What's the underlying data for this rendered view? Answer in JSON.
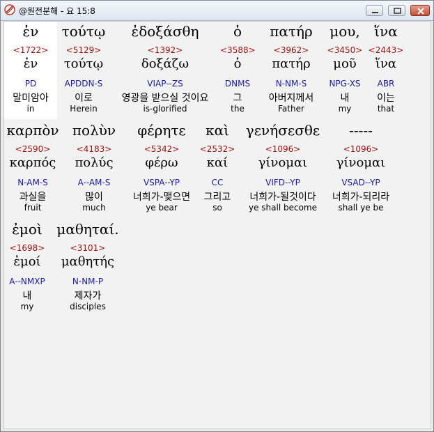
{
  "window": {
    "title": "@원전분해 - 요 15:8"
  },
  "rows": [
    {
      "words": [
        {
          "greek": "ἐν",
          "strong": "<1722>",
          "lemma": "ἐν",
          "parse": "PD",
          "korean": "말미암아",
          "english": "in"
        },
        {
          "greek": "τούτῳ",
          "strong": "<5129>",
          "lemma": "τούτῳ",
          "parse": "APDDN-S",
          "korean": "이로",
          "english": "Herein"
        },
        {
          "greek": "ἐδοξάσθη",
          "strong": "<1392>",
          "lemma": "δοξάζω",
          "parse": "VIAP--ZS",
          "korean": "영광을 받으실 것이요",
          "english": "is-glorified"
        },
        {
          "greek": "ὁ",
          "strong": "<3588>",
          "lemma": "ὁ",
          "parse": "DNMS",
          "korean": "그",
          "english": "the"
        },
        {
          "greek": "πατήρ",
          "strong": "<3962>",
          "lemma": "πατήρ",
          "parse": "N-NM-S",
          "korean": "아버지께서",
          "english": "Father"
        },
        {
          "greek": "μου,",
          "strong": "<3450>",
          "lemma": "μοῦ",
          "parse": "NPG-XS",
          "korean": "내",
          "english": "my"
        },
        {
          "greek": "ἵνα",
          "strong": "<2443>",
          "lemma": "ἵνα",
          "parse": "ABR",
          "korean": "이는",
          "english": "that"
        }
      ]
    },
    {
      "words": [
        {
          "greek": "καρπὸν",
          "strong": "<2590>",
          "lemma": "καρπός",
          "parse": "N-AM-S",
          "korean": "과실을",
          "english": "fruit"
        },
        {
          "greek": "πολὺν",
          "strong": "<4183>",
          "lemma": "πολύς",
          "parse": "A--AM-S",
          "korean": "많이",
          "english": "much"
        },
        {
          "greek": "φέρητε",
          "strong": "<5342>",
          "lemma": "φέρω",
          "parse": "VSPA--YP",
          "korean": "너희가-맺으면",
          "english": "ye bear"
        },
        {
          "greek": "καὶ",
          "strong": "<2532>",
          "lemma": "καί",
          "parse": "CC",
          "korean": "그리고",
          "english": "so"
        },
        {
          "greek": "γενήσεσθε",
          "strong": "<1096>",
          "lemma": "γίνομαι",
          "parse": "VIFD--YP",
          "korean": "너희가-될것이다",
          "english": "ye shall become"
        },
        {
          "greek": "-----",
          "strong": "<1096>",
          "lemma": "γίνομαι",
          "parse": "VSAD--YP",
          "korean": "너희가-되리라",
          "english": "shall ye be"
        }
      ]
    },
    {
      "words": [
        {
          "greek": "ἐμοὶ",
          "strong": "<1698>",
          "lemma": "ἐμοί",
          "parse": "A--NMXP",
          "korean": "내",
          "english": "my"
        },
        {
          "greek": "μαθηταί.",
          "strong": "<3101>",
          "lemma": "μαθητής",
          "parse": "N-NM-P",
          "korean": "제자가",
          "english": "disciples"
        }
      ]
    }
  ]
}
